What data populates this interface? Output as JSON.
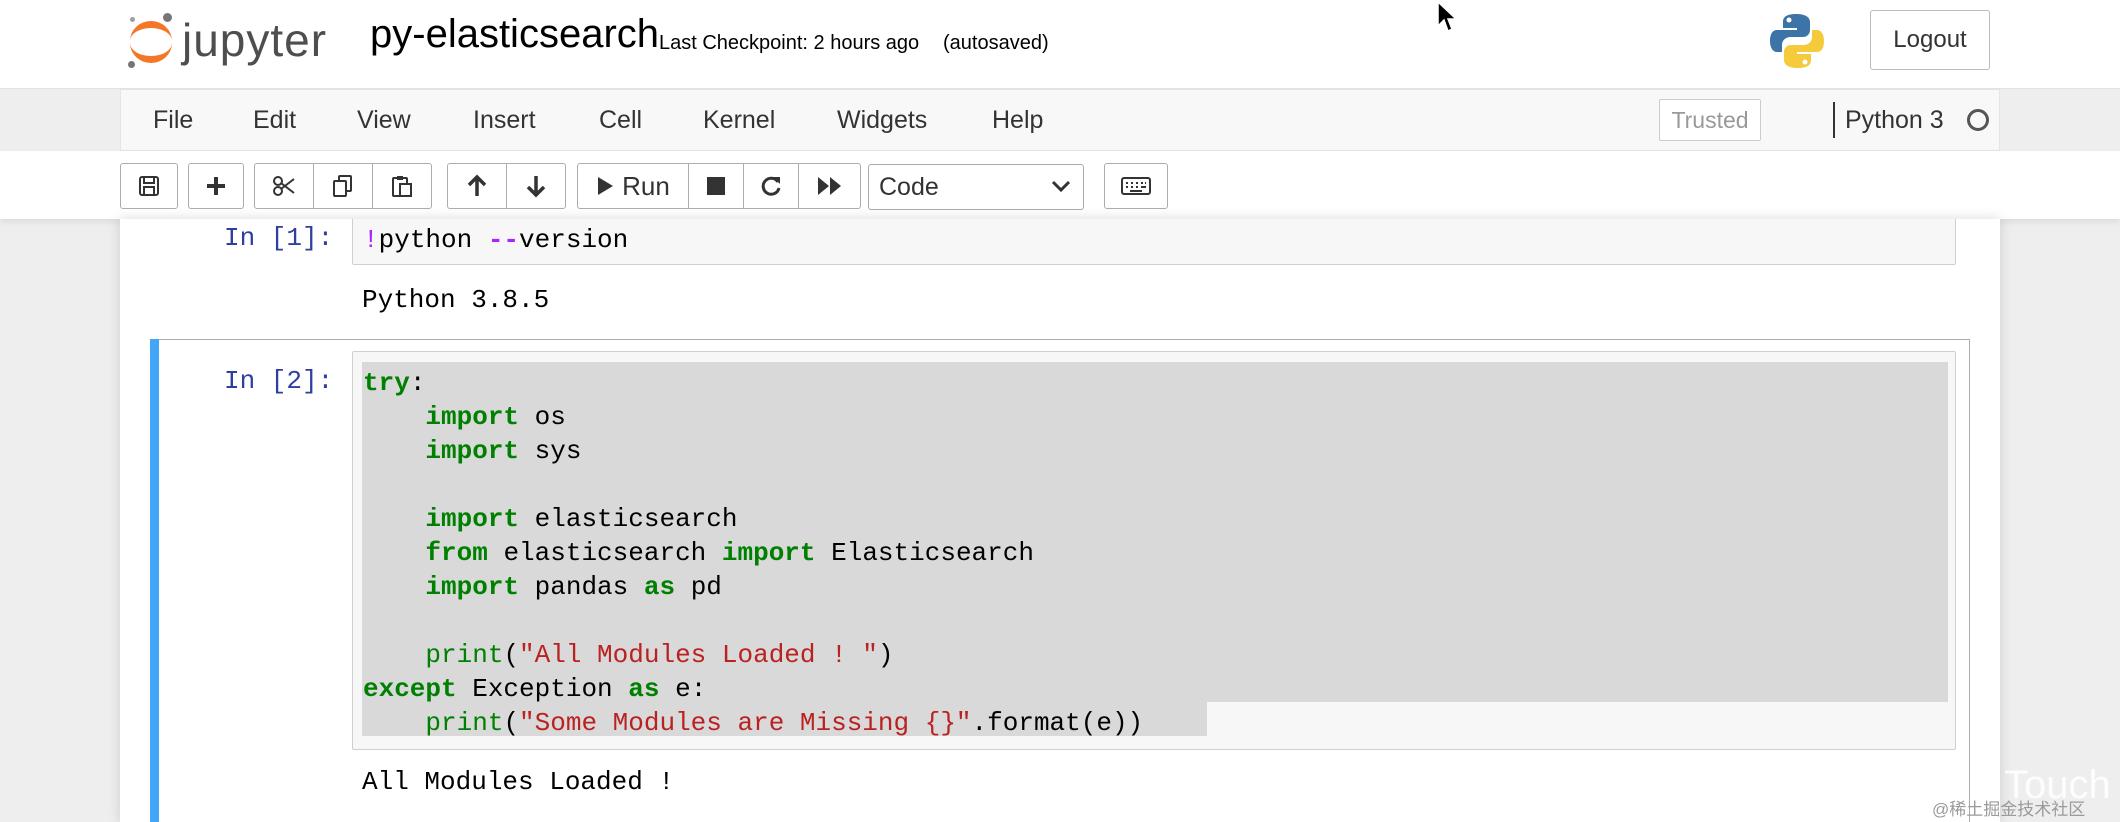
{
  "header": {
    "logo_text": "jupyter",
    "notebook_name": "py-elasticsearch",
    "checkpoint": "Last Checkpoint: 2 hours ago",
    "autosave": "(autosaved)",
    "logout_label": "Logout"
  },
  "menubar": {
    "items": [
      "File",
      "Edit",
      "View",
      "Insert",
      "Cell",
      "Kernel",
      "Widgets",
      "Help"
    ],
    "trusted_label": "Trusted",
    "kernel_name": "Python 3"
  },
  "toolbar": {
    "run_label": "Run",
    "cell_type": "Code"
  },
  "cells": [
    {
      "prompt": "In [1]:",
      "code_bang": "!",
      "code_rest": "python ",
      "code_op": "--",
      "code_tail": "version",
      "output": "Python 3.8.5"
    },
    {
      "prompt": "In [2]:",
      "output": "All Modules Loaded !"
    }
  ],
  "watermark": {
    "text1": "Touch",
    "text2": "@稀土掘金技术社区"
  },
  "colors": {
    "accent_blue": "#42a5f5",
    "keyword": "#008000",
    "string": "#ba2121",
    "prompt": "#303f9f",
    "logo_orange": "#f37726"
  }
}
